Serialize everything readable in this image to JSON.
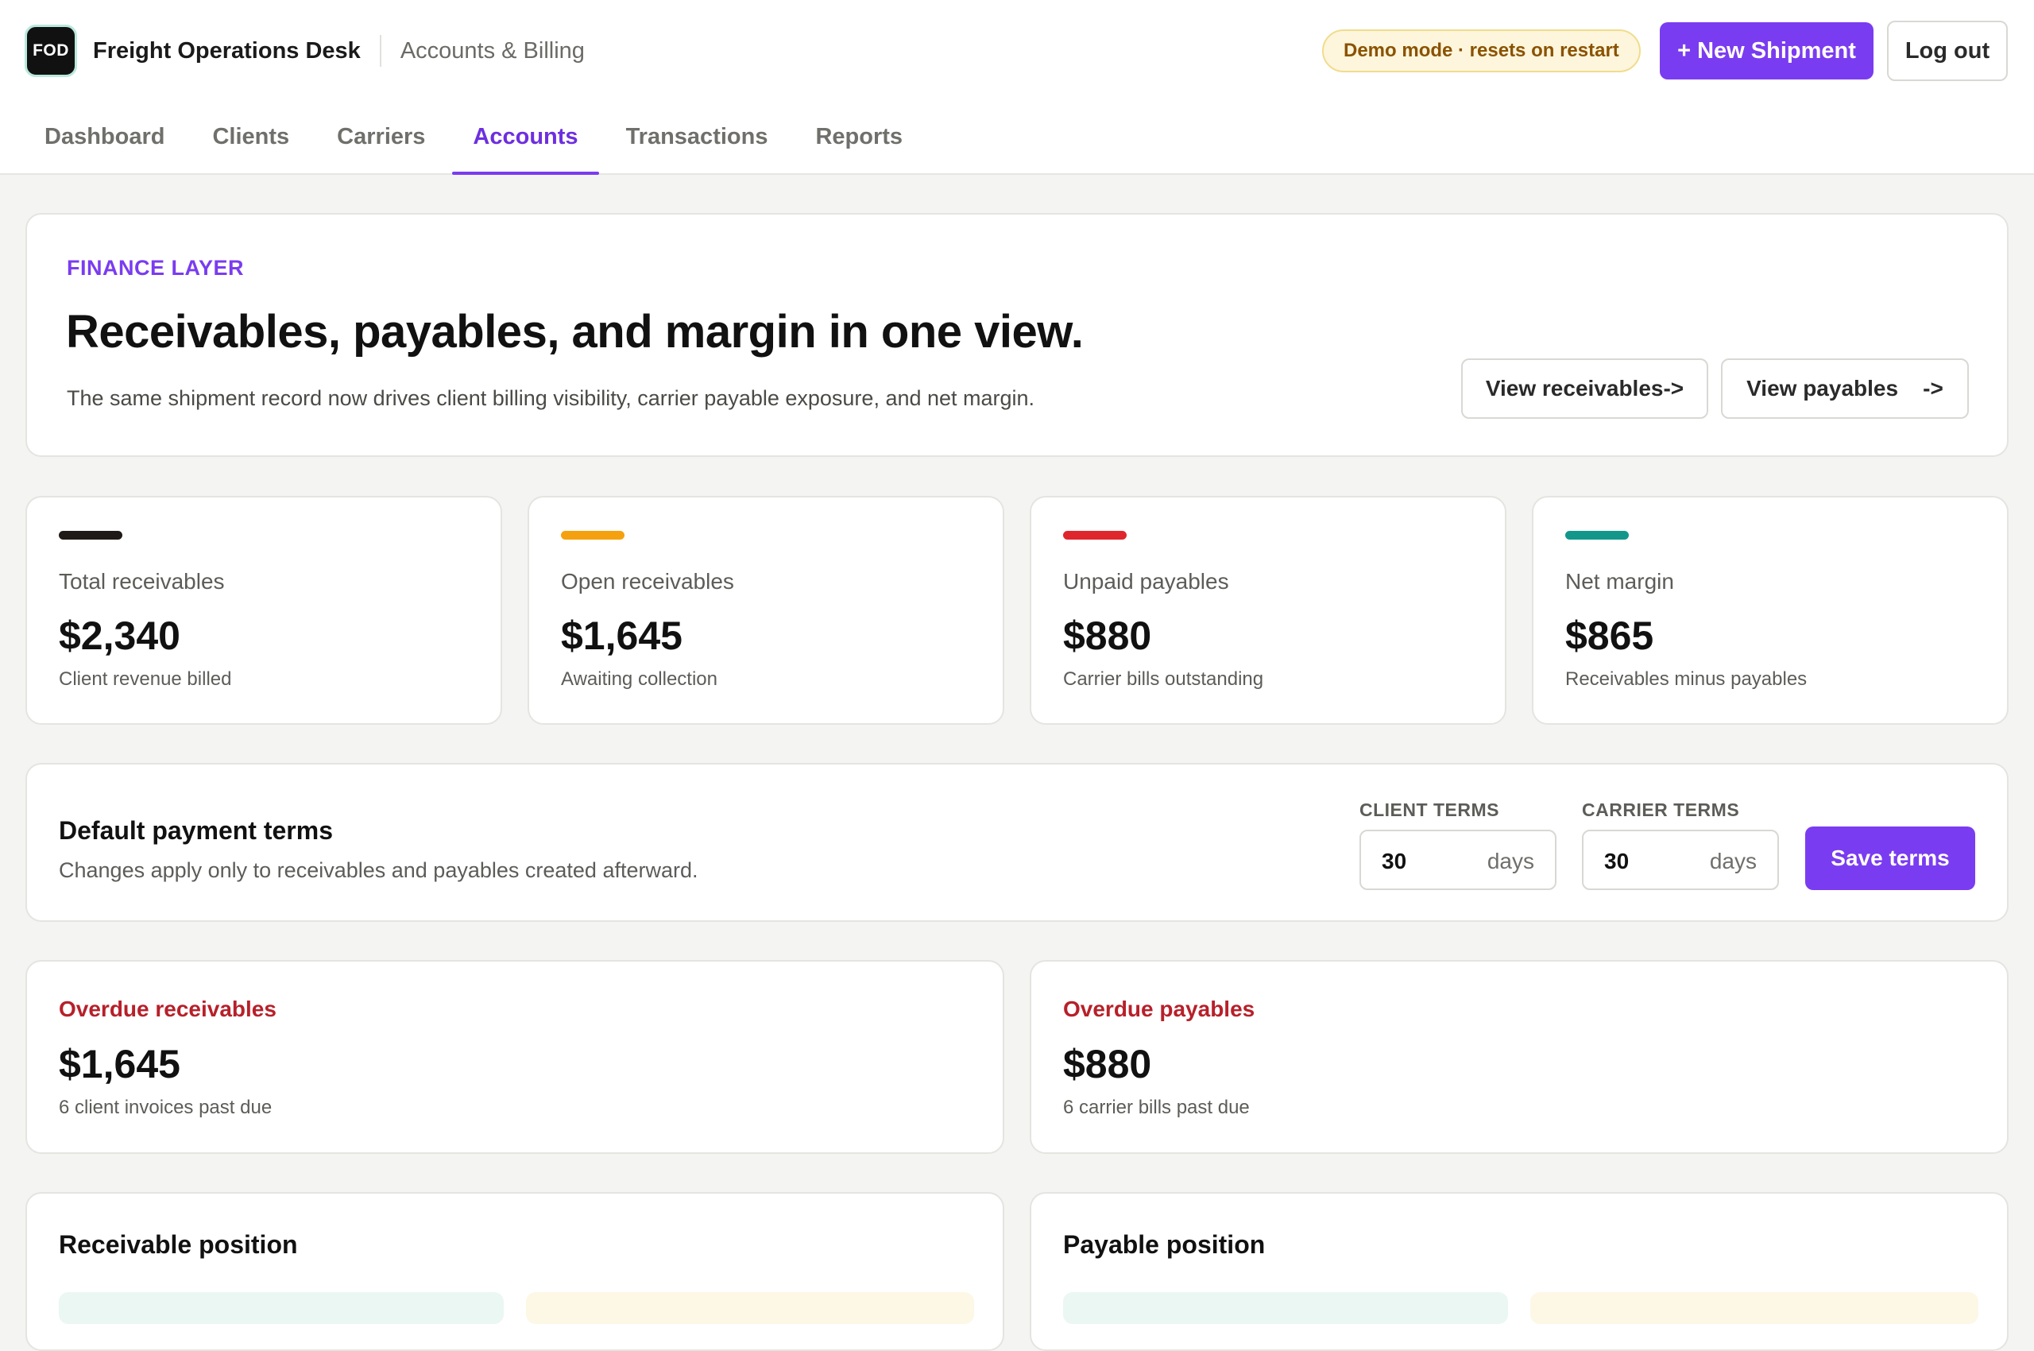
{
  "header": {
    "logo_text": "FOD",
    "app_title": "Freight Operations Desk",
    "section_title": "Accounts & Billing",
    "demo_badge": "Demo mode · resets on restart",
    "new_shipment_label": "+ New Shipment",
    "logout_label": "Log out"
  },
  "nav": {
    "tabs": [
      {
        "label": "Dashboard",
        "active": false
      },
      {
        "label": "Clients",
        "active": false
      },
      {
        "label": "Carriers",
        "active": false
      },
      {
        "label": "Accounts",
        "active": true
      },
      {
        "label": "Transactions",
        "active": false
      },
      {
        "label": "Reports",
        "active": false
      }
    ]
  },
  "hero": {
    "eyebrow": "FINANCE LAYER",
    "title": "Receivables, payables, and margin in one view.",
    "subtitle": "The same shipment record now drives client billing visibility, carrier payable exposure, and net margin.",
    "view_receivables_label": "View receivables->",
    "view_payables_label": "View payables    ->"
  },
  "metrics": [
    {
      "label": "Total receivables",
      "value": "$2,340",
      "hint": "Client revenue billed",
      "color": "#1f1a17"
    },
    {
      "label": "Open receivables",
      "value": "$1,645",
      "hint": "Awaiting collection",
      "color": "#f5a10f"
    },
    {
      "label": "Unpaid payables",
      "value": "$880",
      "hint": "Carrier bills outstanding",
      "color": "#e0262d"
    },
    {
      "label": "Net margin",
      "value": "$865",
      "hint": "Receivables minus payables",
      "color": "#13978a"
    }
  ],
  "terms": {
    "title": "Default payment terms",
    "subtitle": "Changes apply only to receivables and payables created afterward.",
    "client_label": "CLIENT TERMS",
    "client_value": "30",
    "carrier_label": "CARRIER TERMS",
    "carrier_value": "30",
    "unit": "days",
    "save_label": "Save terms"
  },
  "overdue": {
    "receivables": {
      "title": "Overdue receivables",
      "value": "$1,645",
      "hint": "6 client invoices past due"
    },
    "payables": {
      "title": "Overdue payables",
      "value": "$880",
      "hint": "6 carrier bills past due"
    }
  },
  "position": {
    "receivable_title": "Receivable position",
    "payable_title": "Payable position"
  },
  "colors": {
    "accent": "#7a3cf0",
    "danger": "#b7202a"
  }
}
